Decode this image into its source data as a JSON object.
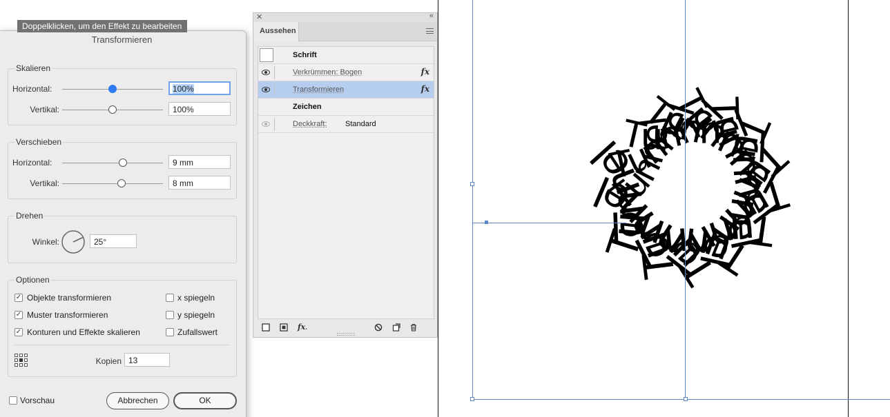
{
  "tooltip": "Doppelklicken, um den Effekt zu bearbeiten",
  "dialog": {
    "title": "Transformieren",
    "scale": {
      "title": "Skalieren",
      "horizontal_label": "Horizontal:",
      "horizontal_value": "100%",
      "horizontal_level": 0.5,
      "vertical_label": "Vertikal:",
      "vertical_value": "100%",
      "vertical_level": 0.5
    },
    "move": {
      "title": "Verschieben",
      "horizontal_label": "Horizontal:",
      "horizontal_value": "9 mm",
      "horizontal_level": 0.6,
      "vertical_label": "Vertikal:",
      "vertical_value": "8 mm",
      "vertical_level": 0.59
    },
    "rotate": {
      "title": "Drehen",
      "angle_label": "Winkel:",
      "angle_value": "25°",
      "angle_degrees": 25
    },
    "options": {
      "title": "Optionen",
      "transform_objects": {
        "label": "Objekte transformieren",
        "checked": true
      },
      "transform_patterns": {
        "label": "Muster transformieren",
        "checked": true
      },
      "scale_strokes": {
        "label": "Konturen und Effekte skalieren",
        "checked": true
      },
      "reflect_x": {
        "label": "x spiegeln",
        "checked": false
      },
      "reflect_y": {
        "label": "y spiegeln",
        "checked": false
      },
      "random": {
        "label": "Zufallswert",
        "checked": false
      },
      "copies_label": "Kopien",
      "copies_value": "13"
    },
    "preview": {
      "label": "Vorschau",
      "checked": false
    },
    "cancel_label": "Abbrechen",
    "ok_label": "OK"
  },
  "appearance": {
    "tab": "Aussehen",
    "rows": {
      "type": "Schrift",
      "warp": "Verkrümmen: Bogen",
      "transform": "Transformieren",
      "characters": "Zeichen",
      "opacity_label": "Deckkraft:",
      "opacity_value": "Standard"
    },
    "fx_glyph": "fx"
  },
  "canvas": {
    "word": "Tunnel",
    "copies": 14,
    "rotation_step_deg": 25
  },
  "colors": {
    "accent": "#2f7cf2",
    "selection_row": "#b5cdef",
    "tooltip_bg": "#727272",
    "bounding_box": "#5a86c5"
  }
}
